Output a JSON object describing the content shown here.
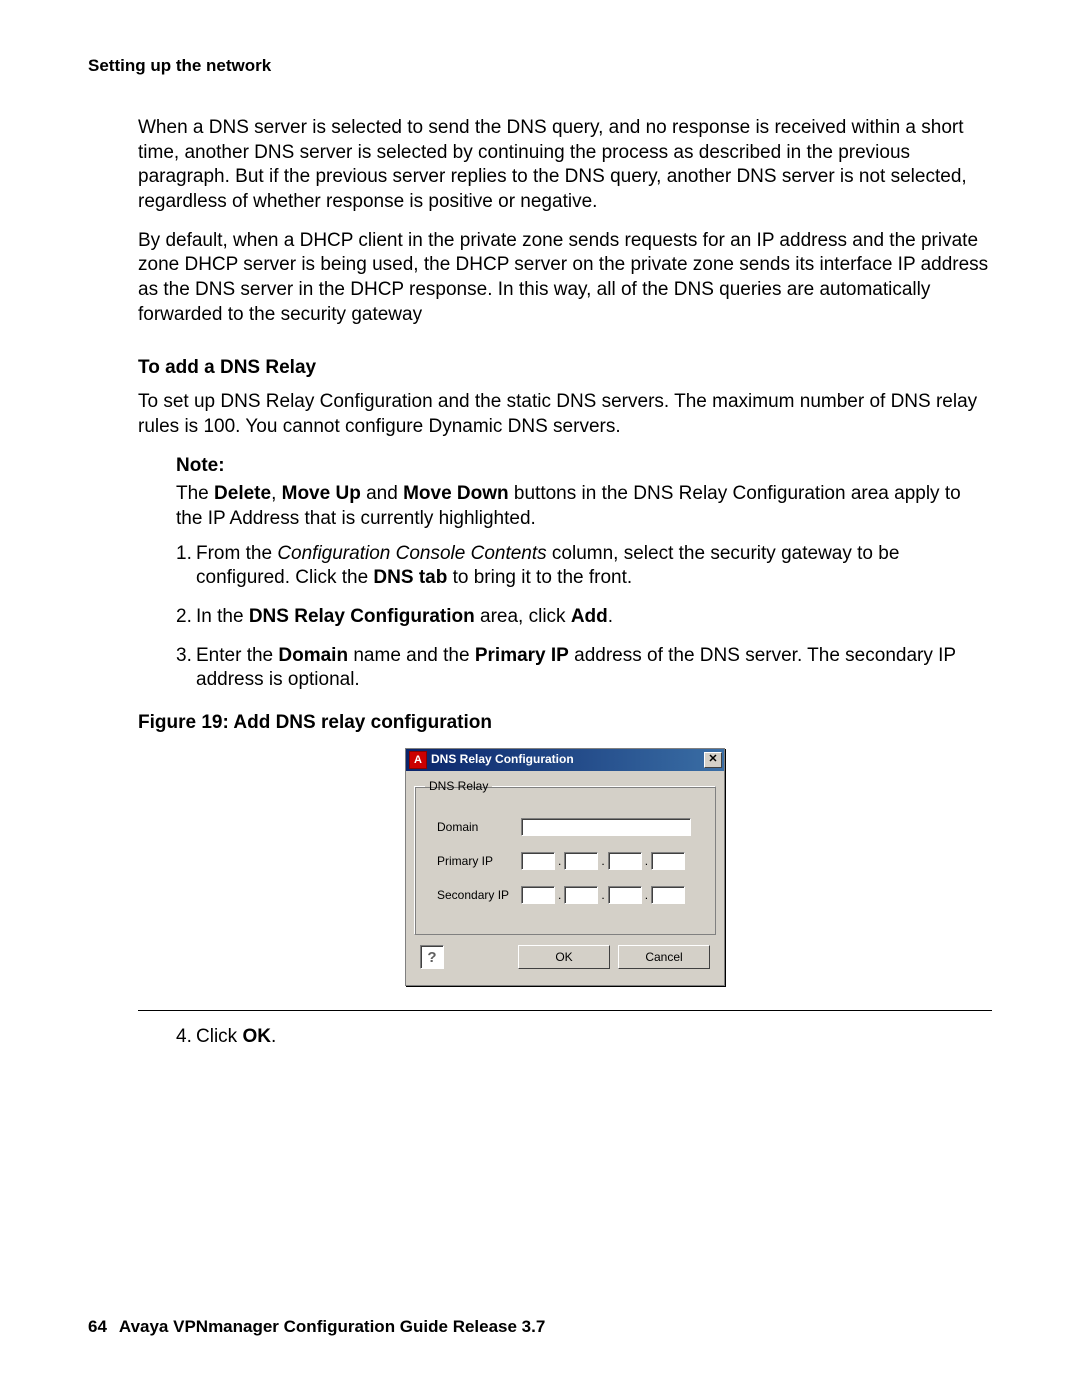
{
  "header": {
    "running": "Setting up the network"
  },
  "body": {
    "para1": "When a DNS server is selected to send the DNS query, and no response is received within a short time, another DNS server is selected by continuing the process as described in the previous paragraph. But if the previous server replies to the DNS query, another DNS server is not selected, regardless of whether response is positive or negative.",
    "para2": "By default, when a DHCP client in the private zone sends requests for an IP address and the private zone DHCP server is being used, the DHCP server on the private zone sends its interface IP address as the DNS server in the DHCP response. In this way, all of the DNS queries are automatically forwarded to the security gateway",
    "section_heading": "To add a DNS Relay",
    "para3": "To set up DNS Relay Configuration and the static DNS servers. The maximum number of DNS relay rules is 100. You cannot configure Dynamic DNS servers.",
    "note_label": "Note:",
    "note_body_pre": "The ",
    "note_body_b1": "Delete",
    "note_body_sep1": ", ",
    "note_body_b2": "Move Up",
    "note_body_sep2": " and ",
    "note_body_b3": "Move Down",
    "note_body_post": " buttons in the DNS Relay Configuration area apply to the IP Address that is currently highlighted.",
    "steps": {
      "s1_no": "1.",
      "s1_pre": "From the ",
      "s1_i": "Configuration Console Contents",
      "s1_mid": " column, select the security gateway to be configured. Click the ",
      "s1_b": "DNS tab",
      "s1_post": " to bring it to the front.",
      "s2_no": "2.",
      "s2_pre": "In the ",
      "s2_b1": "DNS Relay Configuration",
      "s2_mid": " area, click ",
      "s2_b2": "Add",
      "s2_post": ".",
      "s3_no": "3.",
      "s3_pre": "Enter the ",
      "s3_b1": "Domain",
      "s3_mid1": " name and the ",
      "s3_b2": "Primary IP",
      "s3_post": " address of the DNS server. The secondary IP address is optional.",
      "s4_no": "4.",
      "s4_pre": "Click ",
      "s4_b": "OK",
      "s4_post": "."
    },
    "figure_caption": "Figure 19: Add DNS relay configuration"
  },
  "dialog": {
    "title": "DNS Relay Configuration",
    "close_glyph": "✕",
    "app_icon_glyph": "A",
    "legend": "DNS Relay",
    "labels": {
      "domain": "Domain",
      "primary": "Primary IP",
      "secondary": "Secondary IP"
    },
    "help_glyph": "?",
    "ok": "OK",
    "cancel": "Cancel",
    "dot": "."
  },
  "footer": {
    "page_number": "64",
    "doc_title": "Avaya VPNmanager Configuration Guide Release 3.7"
  }
}
